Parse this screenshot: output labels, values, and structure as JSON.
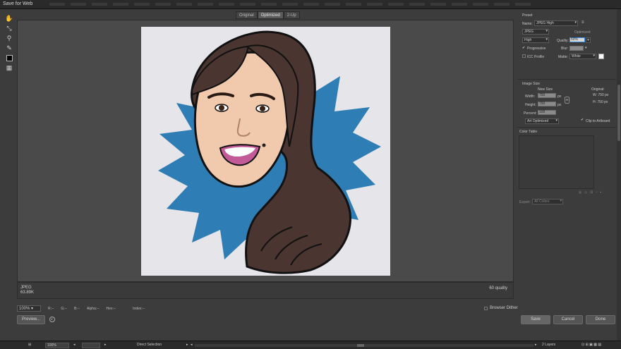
{
  "window": {
    "title": "Save for Web"
  },
  "tabs": [
    {
      "label": "Original",
      "active": false
    },
    {
      "label": "Optimized",
      "active": true
    },
    {
      "label": "2-Up",
      "active": false
    }
  ],
  "preset": {
    "section_label": "Preset",
    "name_label": "Name:",
    "name_value": "JPEG High",
    "format_value": "JPEG",
    "optimized_label": "Optimized",
    "quality_level": "High",
    "quality_label": "Quality:",
    "quality_value": "60%",
    "progressive_label": "Progressive",
    "blur_label": "Blur:",
    "icc_label": "ICC Profile",
    "matte_label": "Matte:",
    "matte_value": "White"
  },
  "image_size": {
    "section_label": "Image Size",
    "new_size_label": "New Size",
    "original_label": "Original:",
    "width_label": "Width:",
    "width_value": "750",
    "height_label": "Height:",
    "height_value": "750",
    "unit": "px",
    "percent_label": "Percent:",
    "percent_value": "100",
    "orig_w": "W:  750 px",
    "orig_h": "H:  750 px",
    "resample_value": "Art Optimized",
    "clip_label": "Clip to Artboard"
  },
  "color_table": {
    "label": "Color Table"
  },
  "export": {
    "label": "Export:",
    "value": "All Colors"
  },
  "info": {
    "format": "JPEG",
    "size": "63.89K",
    "quality": "60 quality"
  },
  "zoom": {
    "value": "100%",
    "readouts": [
      "R:--",
      "G:--",
      "B:--",
      "Alpha:--",
      "Hex:--",
      "Index:--"
    ]
  },
  "preview_button": "Preview...",
  "browser_dither": "Browser Dither",
  "buttons": {
    "save": "Save",
    "cancel": "Cancel",
    "done": "Done"
  },
  "statusbar": {
    "zoom": "100%",
    "tool": "Direct Selection",
    "layers": "2 Layers"
  },
  "colors": {
    "burst": "#2e7db5",
    "hair": "#4a3530",
    "skin": "#f1c9ad",
    "lips": "#c25a98"
  }
}
